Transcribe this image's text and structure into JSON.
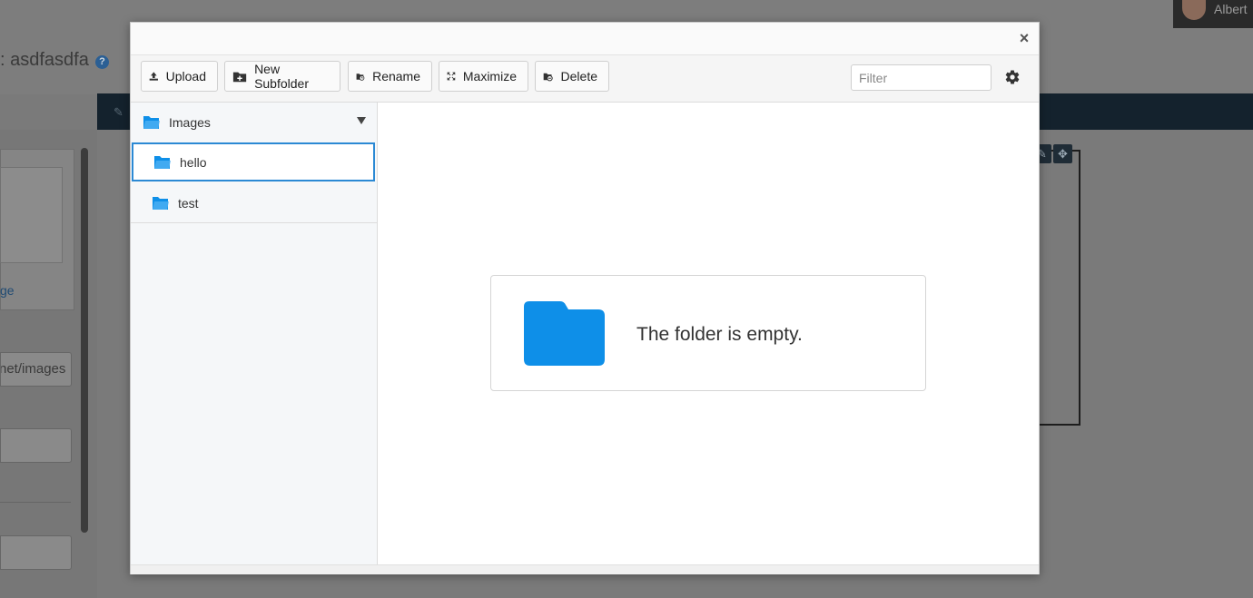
{
  "background": {
    "title": ": asdfasdfa",
    "help_icon": "question-circle-icon",
    "user_name": "Albert",
    "link_text": "ge",
    "path_input_value": "net/images"
  },
  "modal": {
    "close_glyph": "×",
    "toolbar": {
      "upload_label": "Upload",
      "new_subfolder_label": "New Subfolder",
      "rename_label": "Rename",
      "maximize_label": "Maximize",
      "delete_label": "Delete",
      "filter_placeholder": "Filter"
    },
    "tree": {
      "root_label": "Images",
      "items": [
        {
          "label": "hello",
          "selected": true
        },
        {
          "label": "test",
          "selected": false
        }
      ]
    },
    "content": {
      "empty_message": "The folder is empty."
    }
  },
  "colors": {
    "accent": "#2b89d4",
    "folder": "#0e8fe8",
    "navbar": "#14222d"
  }
}
